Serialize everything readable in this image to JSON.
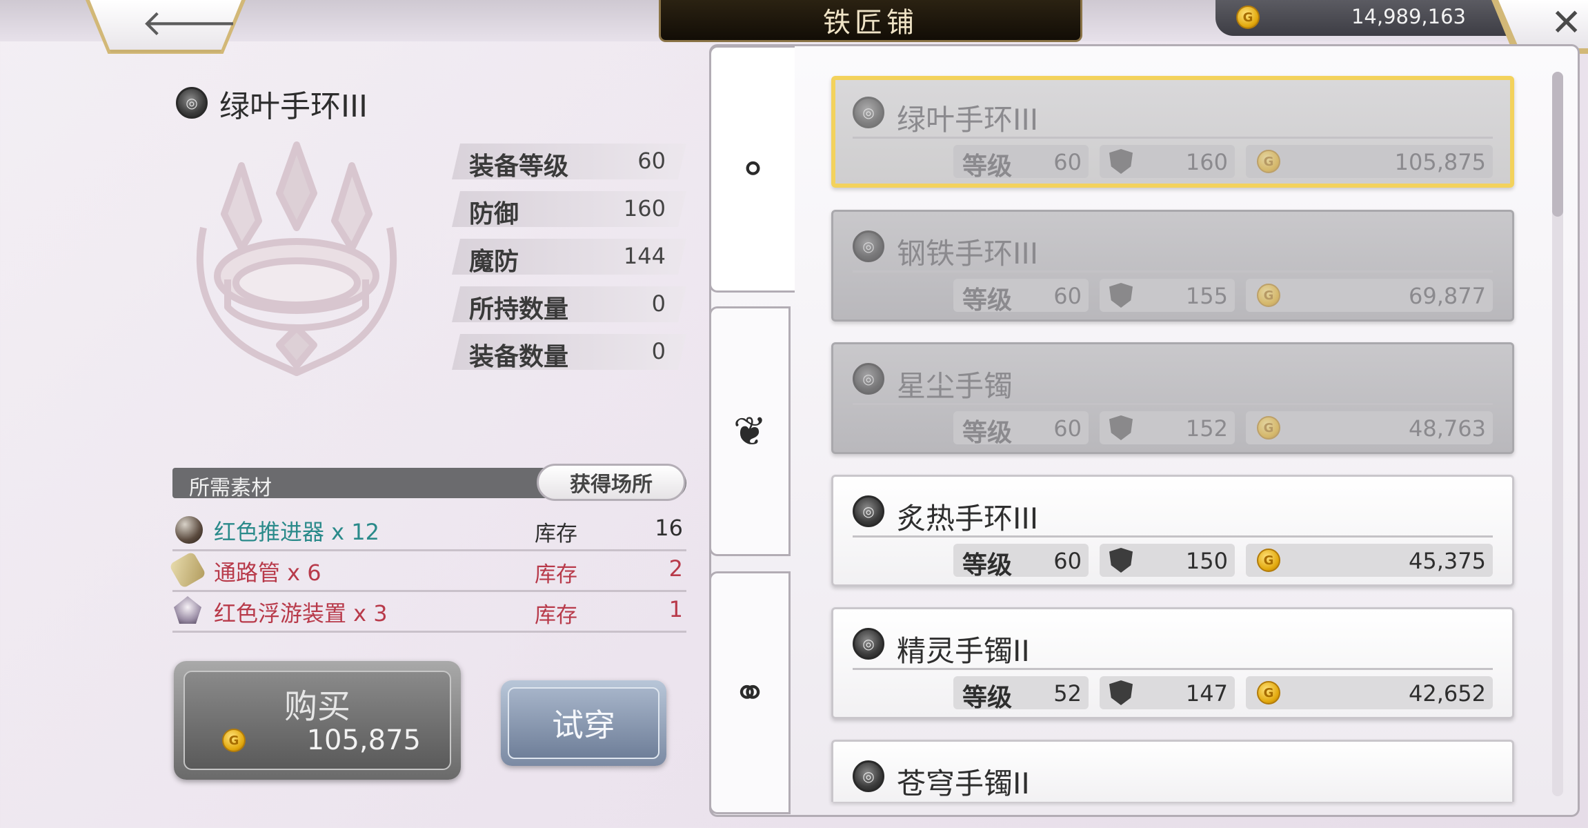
{
  "header": {
    "title": "铁匠铺",
    "back_icon": "arrow-left-icon",
    "close_icon": "close-icon",
    "currency": "14,989,163"
  },
  "detail": {
    "name": "绿叶手环III",
    "stats": [
      {
        "label": "装备等级",
        "value": "60"
      },
      {
        "label": "防御",
        "value": "160"
      },
      {
        "label": "魔防",
        "value": "144"
      },
      {
        "label": "所持数量",
        "value": "0"
      },
      {
        "label": "装备数量",
        "value": "0"
      }
    ],
    "materials_header": "所需素材",
    "obtain_button": "获得场所",
    "materials": [
      {
        "name": "红色推进器 x 12",
        "stock_label": "库存",
        "stock": "16",
        "color": "#2a8a8a"
      },
      {
        "name": "通路管 x 6",
        "stock_label": "库存",
        "stock": "2",
        "color": "#b83a4a"
      },
      {
        "name": "红色浮游装置 x 3",
        "stock_label": "库存",
        "stock": "1",
        "color": "#b83a4a"
      }
    ],
    "buy_label": "购买",
    "buy_price": "105,875",
    "try_label": "试穿"
  },
  "tabs": [
    {
      "name": "bracelet-tab",
      "icon": "bracelet-icon"
    },
    {
      "name": "necklace-tab",
      "icon": "necklace-icon"
    },
    {
      "name": "ring-tab",
      "icon": "ring-icon"
    }
  ],
  "list": {
    "level_label": "等级",
    "items": [
      {
        "name": "绿叶手环III",
        "level": "60",
        "defense": "160",
        "price": "105,875",
        "state": "selected"
      },
      {
        "name": "钢铁手环III",
        "level": "60",
        "defense": "155",
        "price": "69,877",
        "state": "grey"
      },
      {
        "name": "星尘手镯",
        "level": "60",
        "defense": "152",
        "price": "48,763",
        "state": "grey"
      },
      {
        "name": "炙热手环III",
        "level": "60",
        "defense": "150",
        "price": "45,375",
        "state": "normal"
      },
      {
        "name": "精灵手镯II",
        "level": "52",
        "defense": "147",
        "price": "42,652",
        "state": "normal"
      },
      {
        "name": "苍穹手镯II",
        "level": "",
        "defense": "",
        "price": "",
        "state": "normal"
      }
    ]
  },
  "colors": {
    "selected_border": "#f3d25c",
    "gold_trim": "#d2b877",
    "available_material": "#2a8a8a",
    "insufficient_material": "#b83a4a"
  }
}
